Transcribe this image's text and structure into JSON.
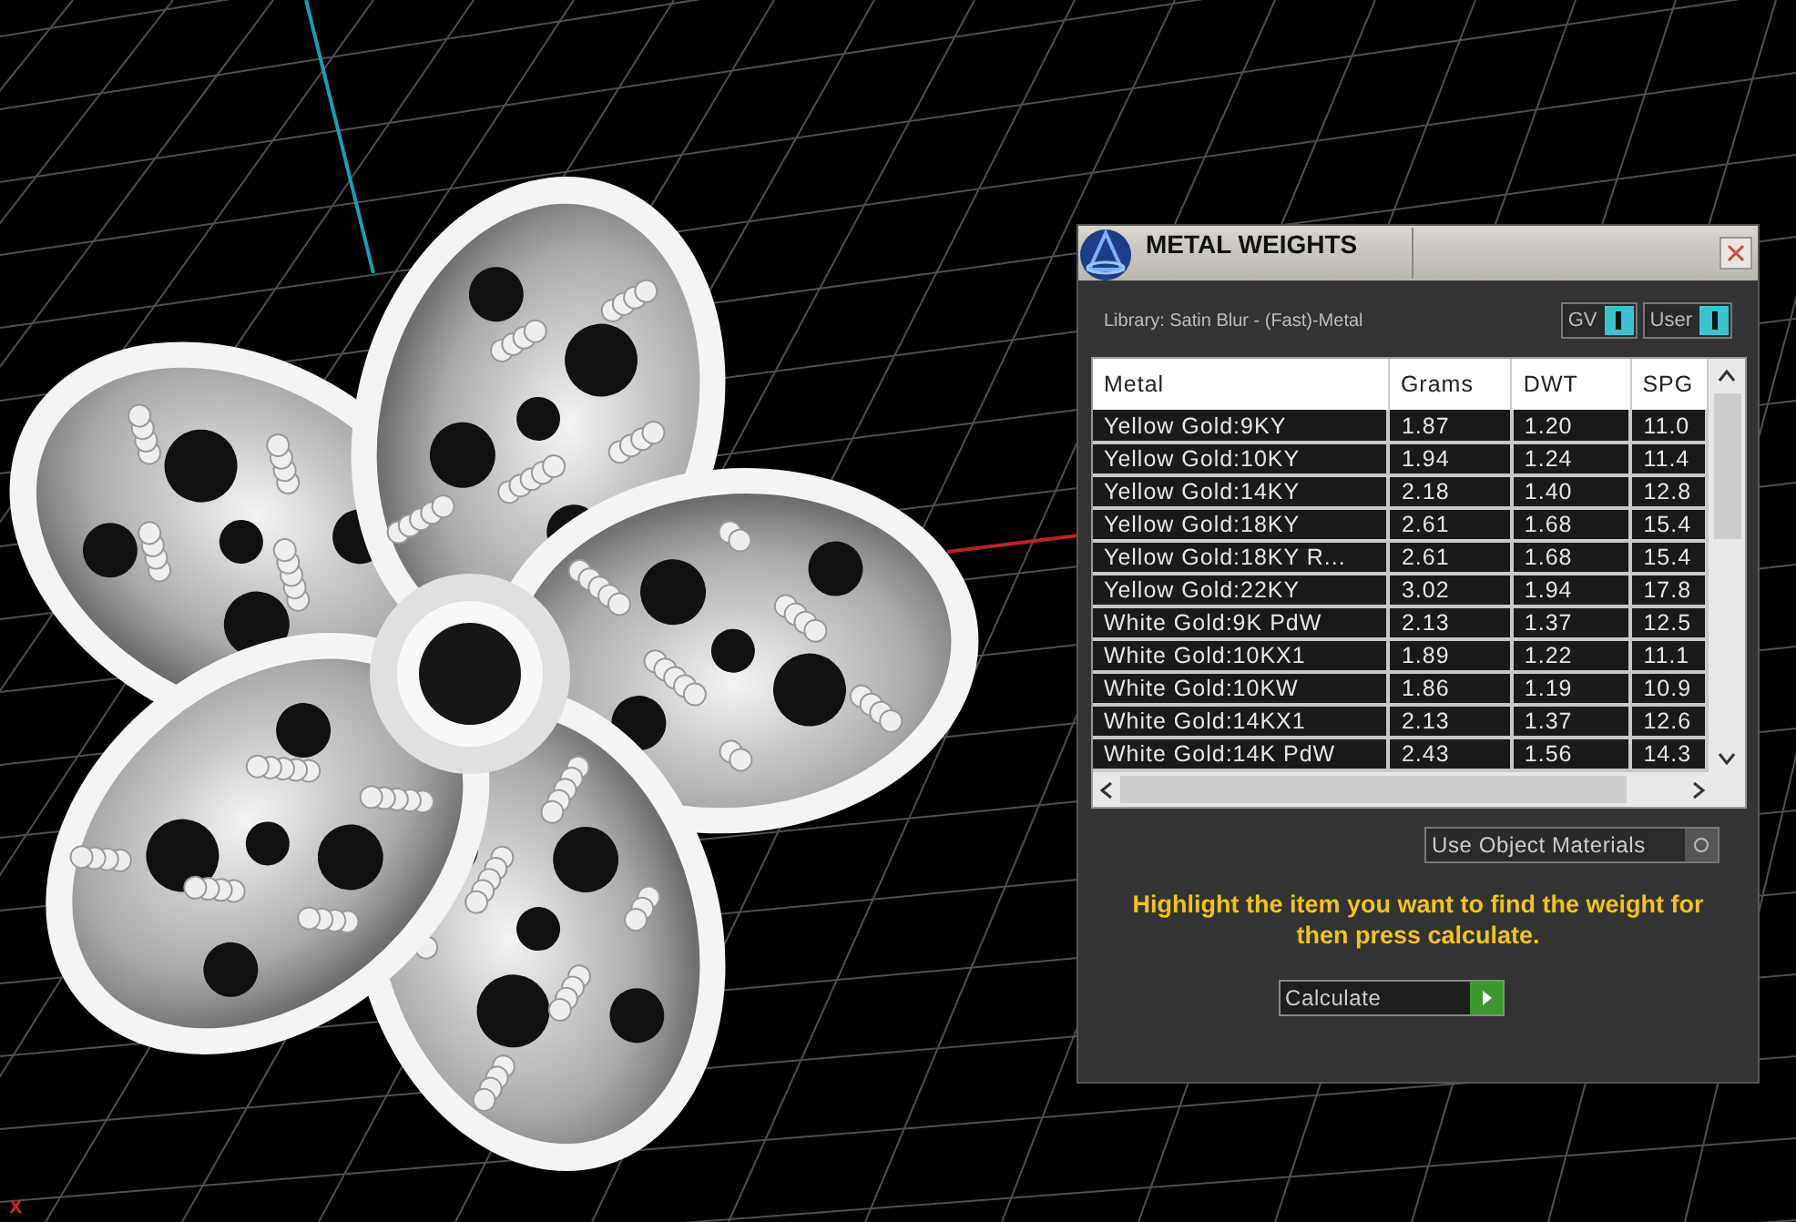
{
  "viewport": {
    "axis_label": "x"
  },
  "panel": {
    "title": "METAL WEIGHTS",
    "library": "Library: Satin Blur - (Fast)-Metal",
    "toggles": [
      {
        "label": "GV",
        "on": true
      },
      {
        "label": "User",
        "on": true
      }
    ],
    "table": {
      "columns": [
        "Metal",
        "Grams",
        "DWT",
        "SPG"
      ],
      "rows": [
        [
          "Yellow Gold:9KY",
          "1.87",
          "1.20",
          "11.0"
        ],
        [
          "Yellow Gold:10KY",
          "1.94",
          "1.24",
          "11.4"
        ],
        [
          "Yellow Gold:14KY",
          "2.18",
          "1.40",
          "12.8"
        ],
        [
          "Yellow Gold:18KY",
          "2.61",
          "1.68",
          "15.4"
        ],
        [
          "Yellow Gold:18KY R...",
          "2.61",
          "1.68",
          "15.4"
        ],
        [
          "Yellow Gold:22KY",
          "3.02",
          "1.94",
          "17.8"
        ],
        [
          "White Gold:9K PdW",
          "2.13",
          "1.37",
          "12.5"
        ],
        [
          "White Gold:10KX1",
          "1.89",
          "1.22",
          "11.1"
        ],
        [
          "White Gold:10KW",
          "1.86",
          "1.19",
          "10.9"
        ],
        [
          "White Gold:14KX1",
          "2.13",
          "1.37",
          "12.6"
        ],
        [
          "White Gold:14K PdW",
          "2.43",
          "1.56",
          "14.3"
        ]
      ]
    },
    "use_object_materials": {
      "label": "Use Object Materials",
      "on": false
    },
    "hint": "Highlight the item you want to find the weight for then press calculate.",
    "calculate_button": "Calculate"
  }
}
